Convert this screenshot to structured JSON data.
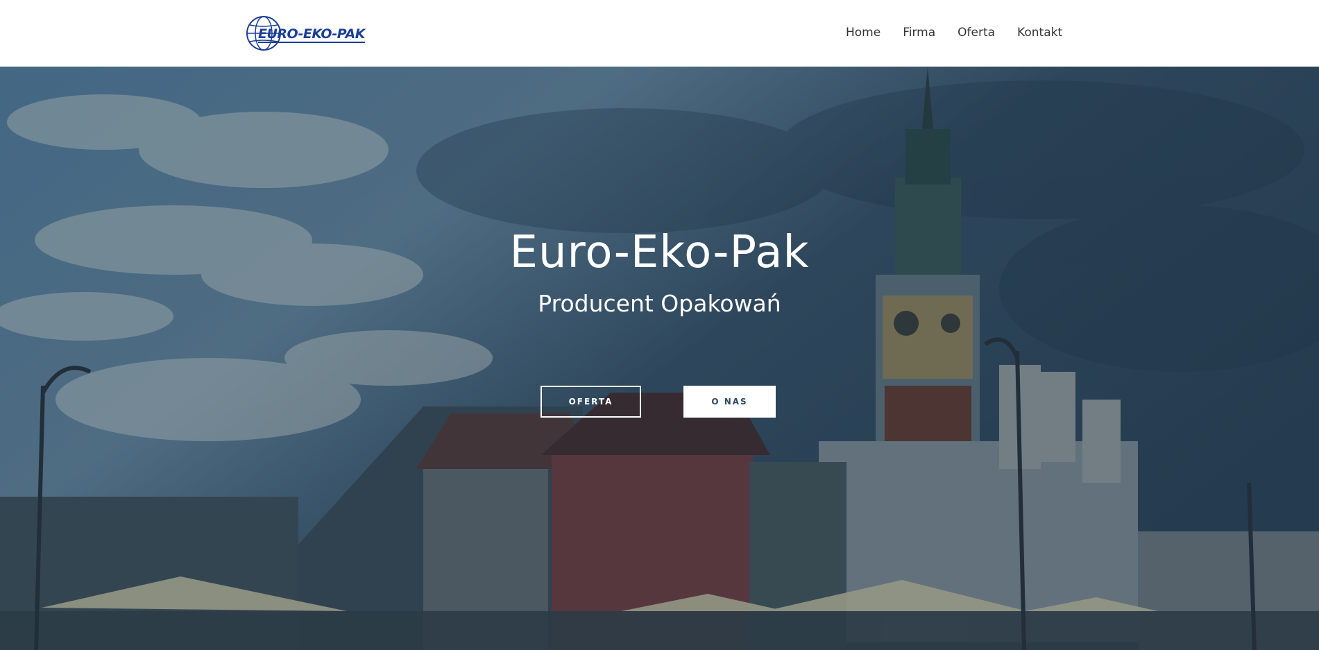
{
  "header": {
    "logo_text": "EURO-EKO-PAK",
    "nav": [
      {
        "label": "Home"
      },
      {
        "label": "Firma"
      },
      {
        "label": "Oferta"
      },
      {
        "label": "Kontakt"
      }
    ]
  },
  "hero": {
    "title": "Euro-Eko-Pak",
    "subtitle": "Producent Opakowań",
    "buttons": {
      "oferta": "OFERTA",
      "o_nas": "O NAS"
    }
  },
  "colors": {
    "brand_blue": "#1b3f97",
    "nav_text": "#333333",
    "button_text_dark": "#2d4a63"
  }
}
